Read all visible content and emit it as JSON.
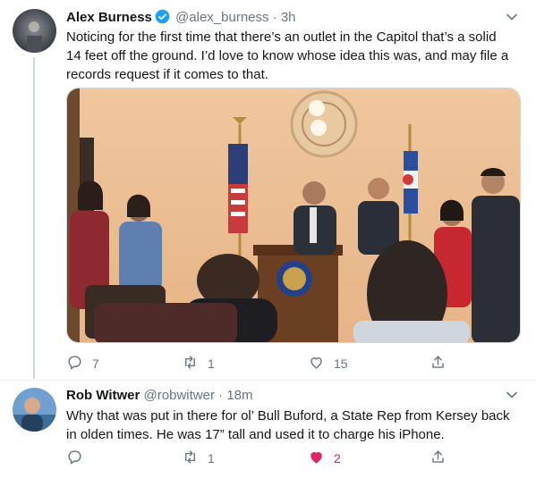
{
  "tweet1": {
    "name": "Alex Burness",
    "handle": "@alex_burness",
    "dot": "·",
    "time": "3h",
    "text": "Noticing for the first time that there’s an outlet in the Capitol that’s a solid 14 feet off the ground. I’d love to know whose idea this was, and may file a records request if it comes to that.",
    "reply_count": "7",
    "retweet_count": "1",
    "like_count": "15",
    "icons": [
      "reply-icon",
      "retweet-icon",
      "like-icon",
      "share-icon",
      "verified-icon",
      "chevron-down-icon"
    ]
  },
  "tweet2": {
    "name": "Rob Witwer",
    "handle": "@robwitwer",
    "dot": "·",
    "time": "18m",
    "text": "Why that was put in there for ol’ Bull Buford, a State Rep from Kersey back in olden times.  He was 17” tall and used it to charge his iPhone.",
    "reply_count": "",
    "retweet_count": "1",
    "like_count": "2",
    "liked": true
  },
  "colors": {
    "text": "#14171a",
    "muted": "#657786",
    "verified": "#1da1f2",
    "like_active": "#e0245e",
    "divider": "#e6ecf0"
  }
}
